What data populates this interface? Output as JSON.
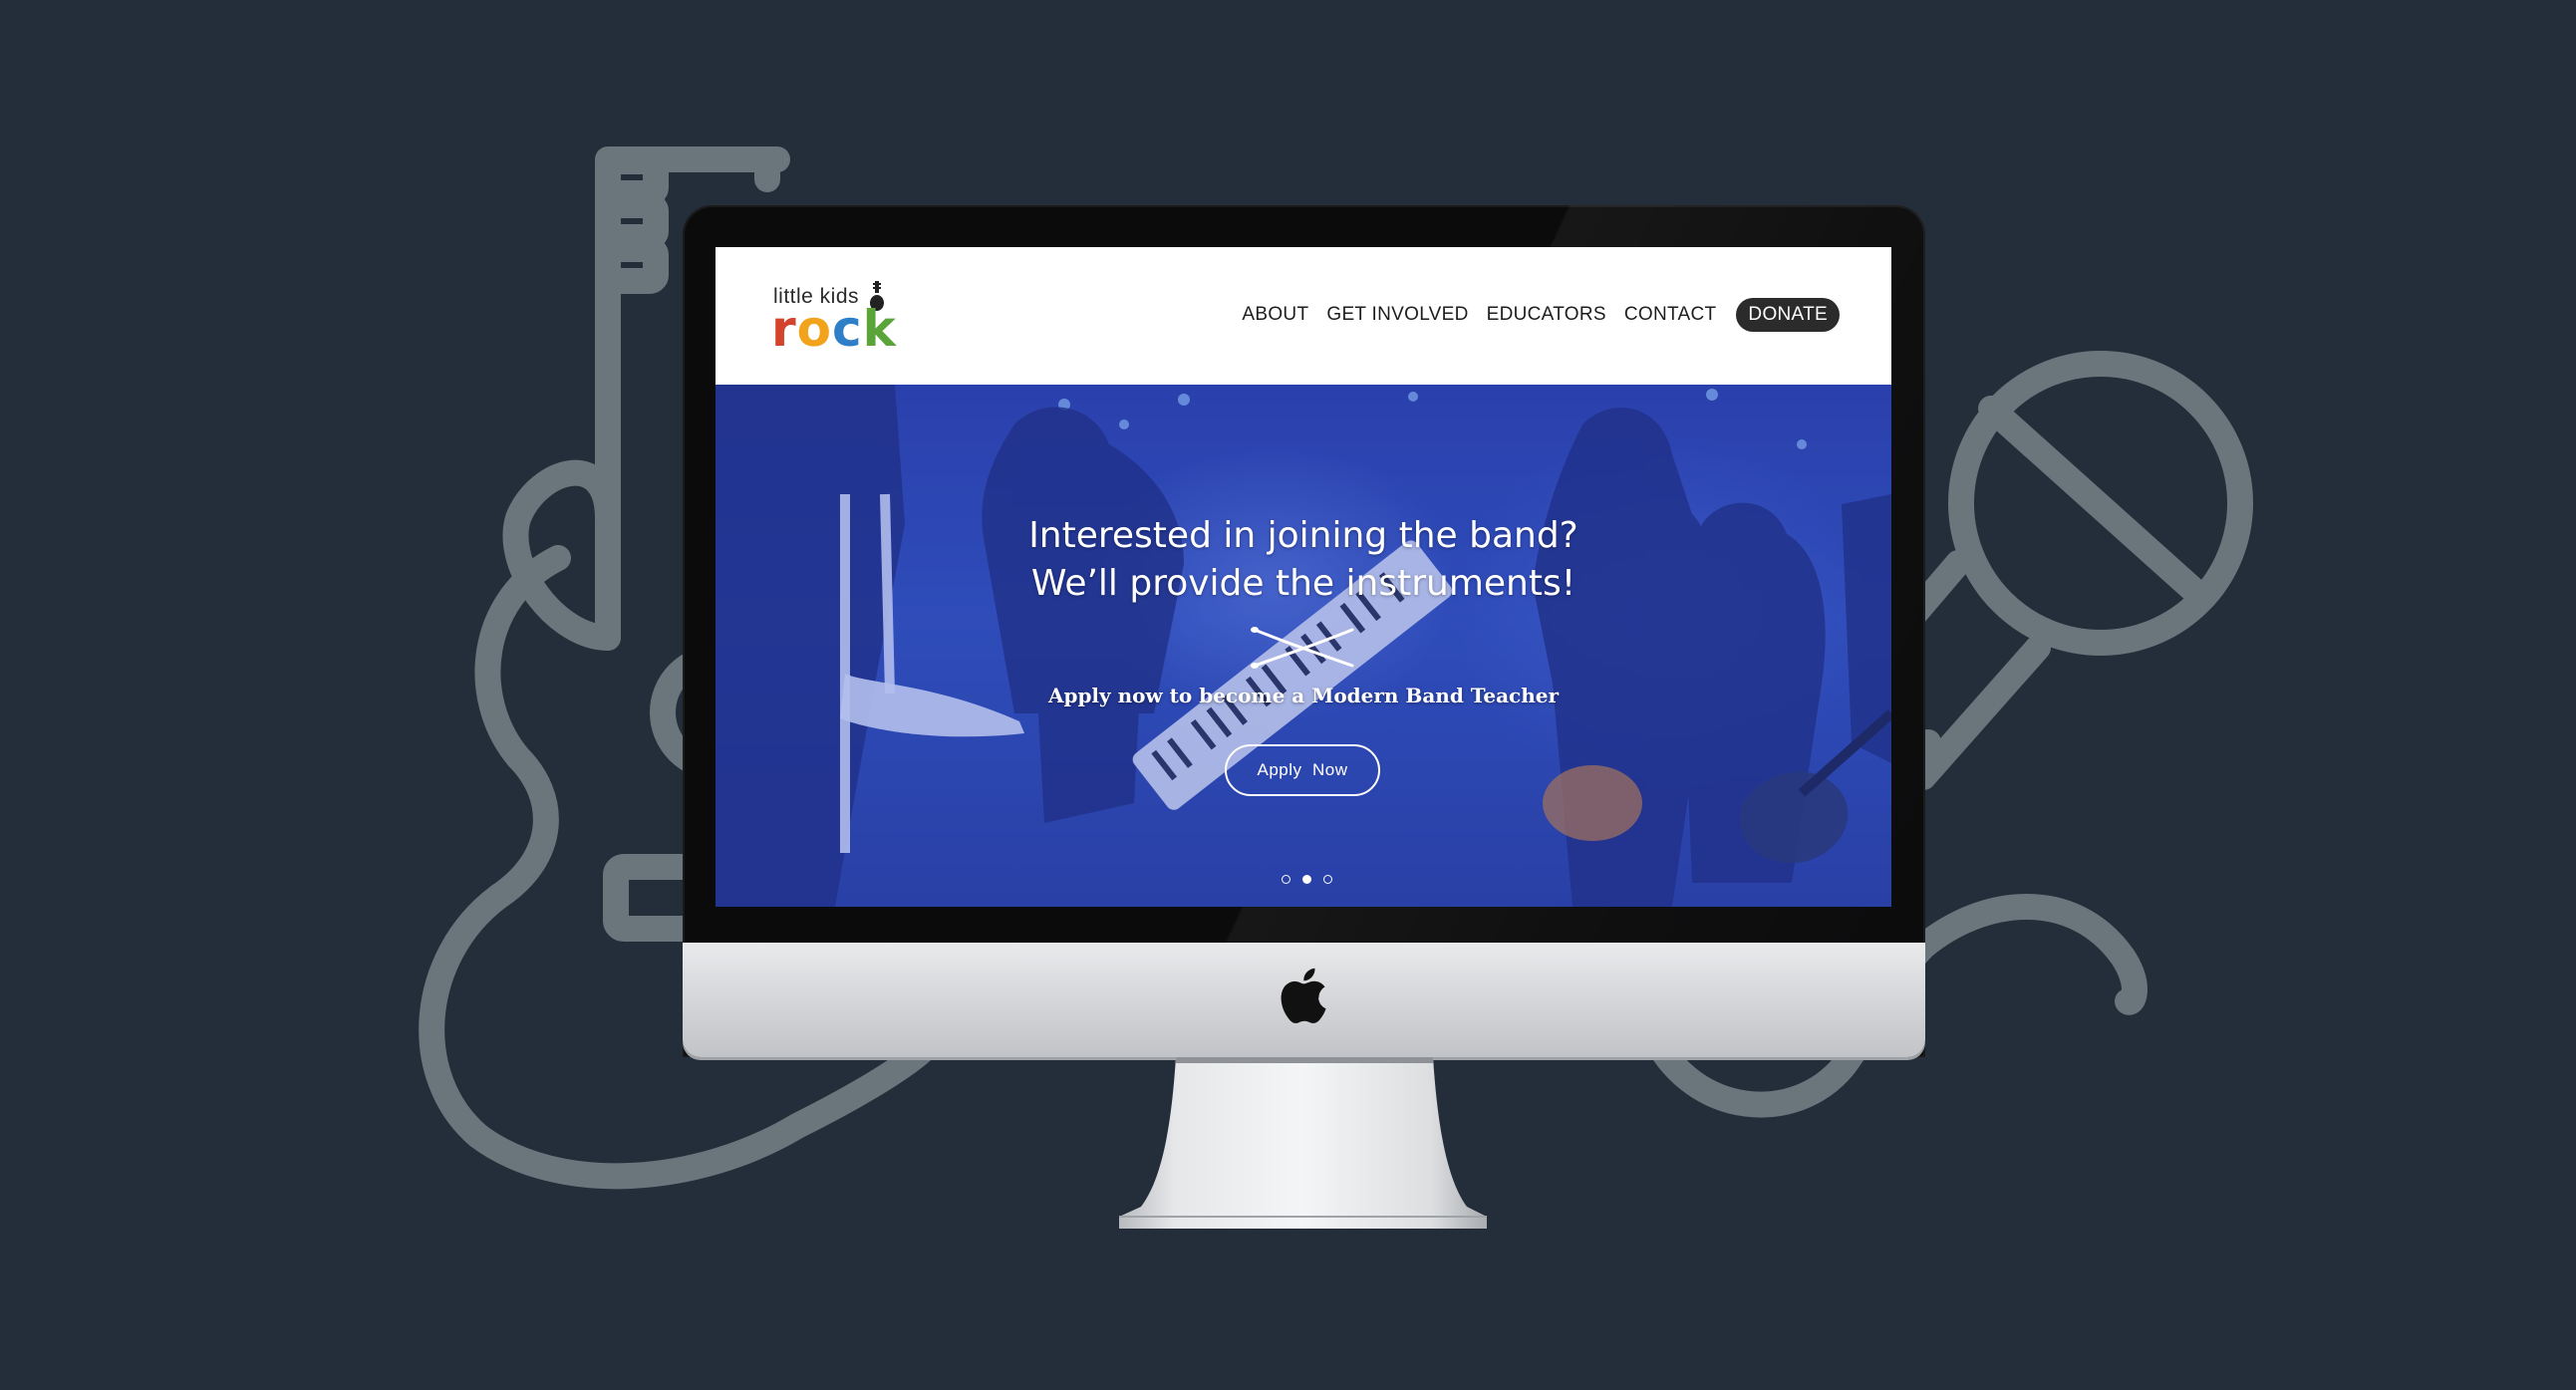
{
  "colors": {
    "background": "#232e3a",
    "outline_icons": "#6b757c",
    "hero_blue": "#3250b8",
    "donate_bg": "#2b2b2b"
  },
  "decor": {
    "left_icon": "guitar-outline-icon",
    "right_icon": "microphone-outline-icon",
    "device": "imac-monitor",
    "brand_icon": "apple-icon"
  },
  "site": {
    "logo": {
      "line1": "little kids",
      "letters": [
        "r",
        "o",
        "c",
        "k"
      ],
      "letter_colors": [
        "#d4432c",
        "#f0a31b",
        "#2f7fc8",
        "#5aa43a"
      ]
    },
    "nav": {
      "items": [
        "ABOUT",
        "GET INVOLVED",
        "EDUCATORS",
        "CONTACT"
      ],
      "donate": "DONATE"
    },
    "hero": {
      "title_line1": "Interested in joining the band?",
      "title_line2": "We’ll provide the instruments!",
      "subtitle": "Apply now to become a Modern Band Teacher",
      "button": "Apply  Now",
      "slides_count": 3,
      "active_slide": 2
    }
  }
}
